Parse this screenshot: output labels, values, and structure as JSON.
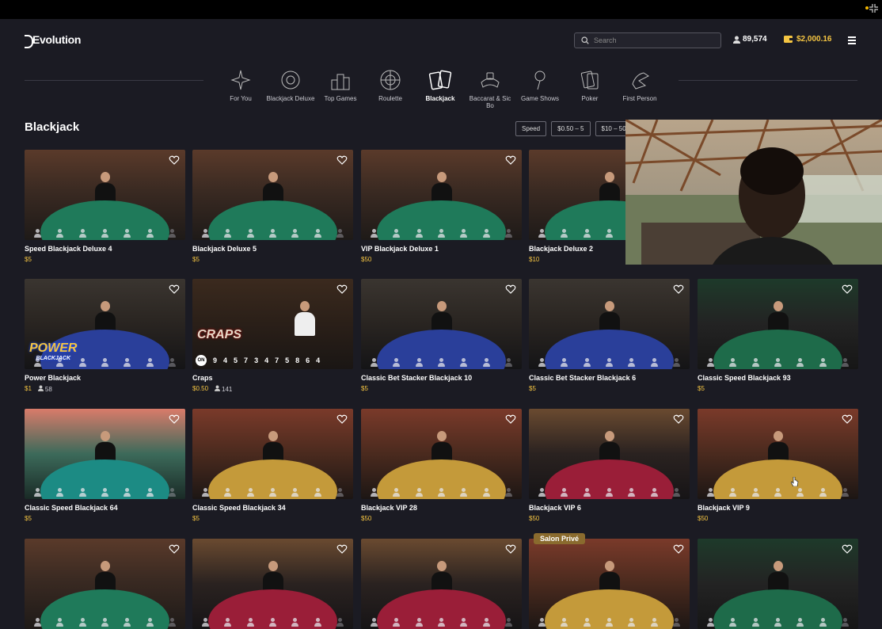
{
  "header": {
    "brand": "Evolution",
    "search_placeholder": "Search",
    "players_online": "89,574",
    "balance": "$2,000.16"
  },
  "categories": [
    {
      "label": "For You",
      "icon": "sparkle-icon"
    },
    {
      "label": "Blackjack Deluxe",
      "icon": "chip-icon"
    },
    {
      "label": "Top Games",
      "icon": "podium-icon"
    },
    {
      "label": "Roulette",
      "icon": "roulette-icon"
    },
    {
      "label": "Blackjack",
      "icon": "cards-icon",
      "active": true
    },
    {
      "label": "Baccarat & Sic Bo",
      "icon": "dice-icon"
    },
    {
      "label": "Game Shows",
      "icon": "microphone-icon"
    },
    {
      "label": "Poker",
      "icon": "poker-cards-icon"
    },
    {
      "label": "First Person",
      "icon": "hand-icon"
    }
  ],
  "section": {
    "title": "Blackjack",
    "filters": [
      "Speed",
      "$0.50 – 5",
      "$10 – 50"
    ]
  },
  "games": [
    {
      "name": "Speed Blackjack Deluxe 4",
      "limit": "$5",
      "scene": "green"
    },
    {
      "name": "Blackjack Deluxe 5",
      "limit": "$5",
      "scene": "green"
    },
    {
      "name": "VIP Blackjack Deluxe 1",
      "limit": "$50",
      "scene": "green"
    },
    {
      "name": "Blackjack Deluxe 2",
      "limit": "$10",
      "scene": "green"
    },
    {
      "name": "Power Blackjack",
      "limit": "$1",
      "players": "58",
      "scene": "blue",
      "logo": "POWER",
      "logo_sub": "BLACKJACK"
    },
    {
      "name": "Craps",
      "limit": "$0.50",
      "players": "141",
      "scene": "craps",
      "logo": "CRAPS",
      "badge": "ON",
      "history": [
        "9",
        "4",
        "5",
        "7",
        "3",
        "4",
        "7",
        "5",
        "8",
        "6",
        "4"
      ]
    },
    {
      "name": "Classic Bet Stacker Blackjack 10",
      "limit": "$5",
      "scene": "blue"
    },
    {
      "name": "Classic Bet Stacker Blackjack 6",
      "limit": "$5",
      "scene": "blue"
    },
    {
      "name": "Classic Speed Blackjack 93",
      "limit": "$5",
      "scene": "greenDark"
    },
    {
      "name": "Classic Speed Blackjack 64",
      "limit": "$5",
      "scene": "teal"
    },
    {
      "name": "Classic Speed Blackjack 34",
      "limit": "$5",
      "scene": "gold"
    },
    {
      "name": "Blackjack VIP 28",
      "limit": "$50",
      "scene": "gold"
    },
    {
      "name": "Blackjack VIP 6",
      "limit": "$50",
      "scene": "red"
    },
    {
      "name": "Blackjack VIP 9",
      "limit": "$50",
      "scene": "gold"
    },
    {
      "name": "",
      "limit": "",
      "scene": "green"
    },
    {
      "name": "",
      "limit": "",
      "scene": "red"
    },
    {
      "name": "",
      "limit": "",
      "scene": "red"
    },
    {
      "name": "",
      "limit": "",
      "scene": "gold",
      "badge": "Salon Privé"
    },
    {
      "name": "",
      "limit": "",
      "scene": "greenDark"
    }
  ]
}
